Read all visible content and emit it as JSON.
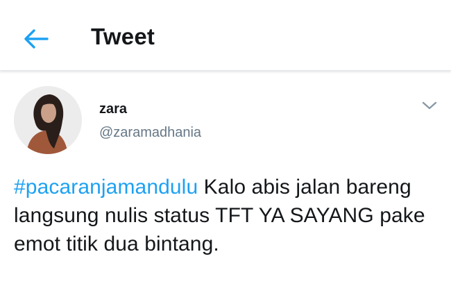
{
  "header": {
    "back_icon": "arrow-left-icon",
    "title": "Tweet"
  },
  "tweet": {
    "author": {
      "display_name": "zara",
      "handle": "@zaramadhania",
      "avatar_icon": "user-avatar"
    },
    "menu_icon": "chevron-down-icon",
    "hashtag": "#pacaranjamandulu",
    "text": " Kalo abis jalan bareng langsung nulis status TFT YA SAYANG pake emot titik dua bintang."
  },
  "colors": {
    "accent": "#1da1f2",
    "text": "#14171a",
    "secondary": "#657786"
  }
}
